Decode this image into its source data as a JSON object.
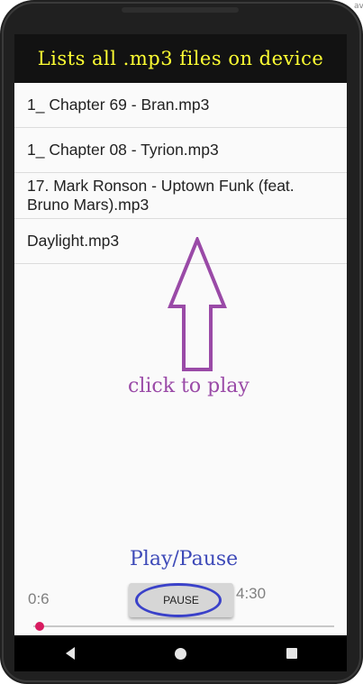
{
  "app": {
    "banner_title": "Lists all .mp3 files on device"
  },
  "files": [
    "1_ Chapter 69 - Bran.mp3",
    "1_ Chapter 08 - Tyrion.mp3",
    "17. Mark Ronson - Uptown Funk (feat. Bruno Mars).mp3",
    "Daylight.mp3"
  ],
  "annotations": {
    "click_hint": "click to play",
    "play_pause_hint": "Play/Pause"
  },
  "player": {
    "current_time": "0:6",
    "total_time": "4:30",
    "pause_label": "PAUSE",
    "progress_fraction": 0.02
  },
  "nav": {
    "back_icon": "back-triangle-icon",
    "home_icon": "home-circle-icon",
    "recents_icon": "recents-square-icon"
  },
  "edge_text": "av",
  "colors": {
    "banner_bg": "#121212",
    "banner_text": "#ffff33",
    "annotation_purple": "#9a4aa7",
    "annotation_blue": "#3d49b8",
    "seek_thumb": "#d81b60"
  }
}
